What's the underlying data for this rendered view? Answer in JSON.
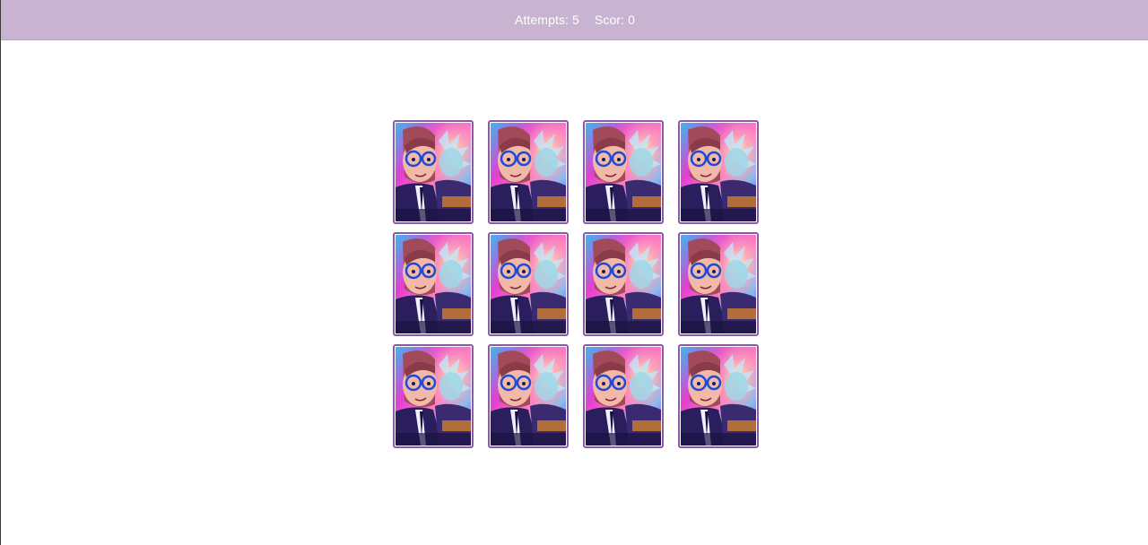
{
  "header": {
    "attempts_label": "Attempts:",
    "attempts_value": "5",
    "score_label": "Scor:",
    "score_value": "0"
  },
  "colors": {
    "header_bg": "#c8b4d0",
    "card_border": "#8a5aa6",
    "page_bg": "#ffffff"
  },
  "board": {
    "rows": 3,
    "columns": 4,
    "cards": [
      {
        "state": "face-down",
        "back": "rick-and-morty-art"
      },
      {
        "state": "face-down",
        "back": "rick-and-morty-art"
      },
      {
        "state": "face-down",
        "back": "rick-and-morty-art"
      },
      {
        "state": "face-down",
        "back": "rick-and-morty-art"
      },
      {
        "state": "face-down",
        "back": "rick-and-morty-art"
      },
      {
        "state": "face-down",
        "back": "rick-and-morty-art"
      },
      {
        "state": "face-down",
        "back": "rick-and-morty-art"
      },
      {
        "state": "face-down",
        "back": "rick-and-morty-art"
      },
      {
        "state": "face-down",
        "back": "rick-and-morty-art"
      },
      {
        "state": "face-down",
        "back": "rick-and-morty-art"
      },
      {
        "state": "face-down",
        "back": "rick-and-morty-art"
      },
      {
        "state": "face-down",
        "back": "rick-and-morty-art"
      }
    ]
  }
}
